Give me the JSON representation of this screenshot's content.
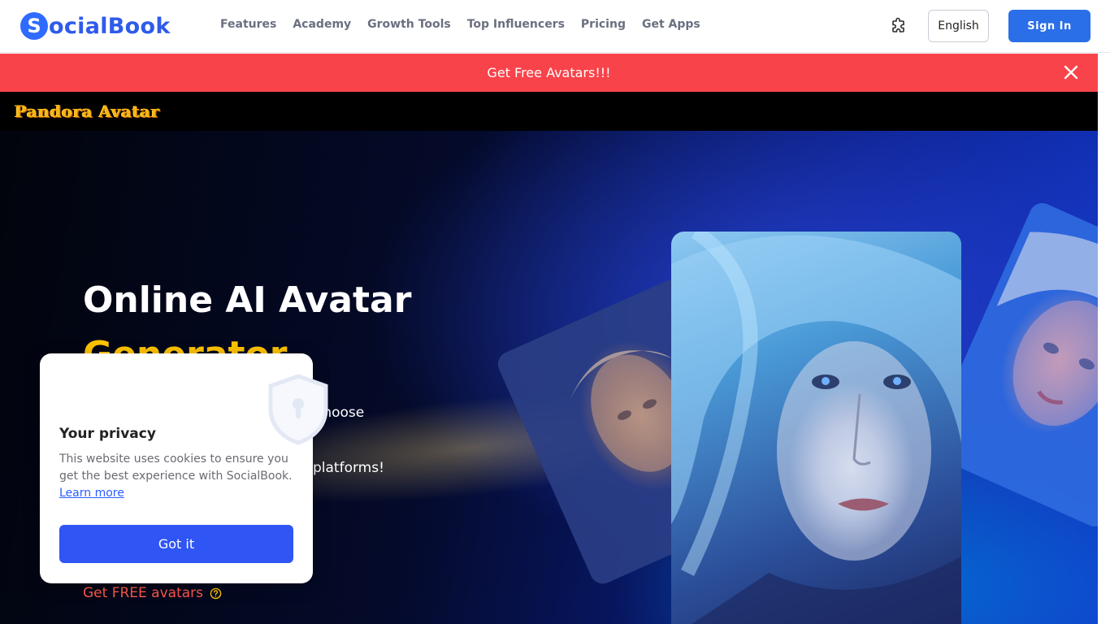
{
  "nav": {
    "logo_mark": "S",
    "logo_text": "ocialBook",
    "links": [
      "Features",
      "Academy",
      "Growth Tools",
      "Top Influencers",
      "Pricing",
      "Get Apps"
    ],
    "language": "English",
    "signin": "Sign In",
    "extension_icon": "puzzle-icon"
  },
  "promo": {
    "text": "Get Free Avatars!!!",
    "close_icon": "close-icon",
    "color": "#f9434a"
  },
  "subbar": {
    "brand": "Pandora Avatar",
    "brand_color": "#f7b614"
  },
  "hero": {
    "title_line1": "Online AI Avatar",
    "title_line2": "Generator",
    "desc_part1": "choose",
    "desc_part2": "platforms!",
    "cta": "Get FREE avatars",
    "cta_icon": "help-circle-icon",
    "accent": "#ffc400"
  },
  "cookie": {
    "icon": "shield-keyhole-icon",
    "title": "Your privacy",
    "body": "This website uses cookies to ensure you get the best experience with SocialBook.",
    "link": "Learn more",
    "button": "Got it",
    "button_color": "#2f55f5"
  },
  "colors": {
    "brand_blue": "#2f5bea",
    "signin_blue": "#2a6fe8"
  }
}
